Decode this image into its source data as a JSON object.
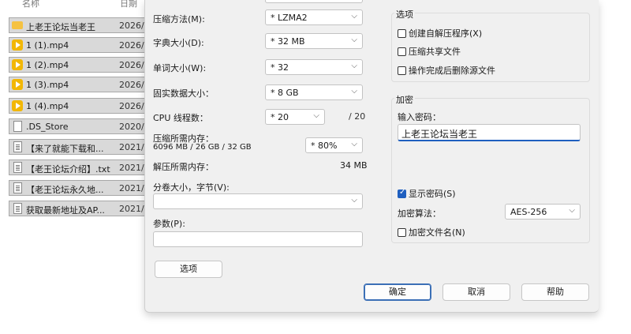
{
  "file_list": {
    "headers": {
      "name": "名称",
      "date": "日期"
    },
    "rows": [
      {
        "icon": "folder-icon",
        "name": "上老王论坛当老王",
        "date": "2026/"
      },
      {
        "icon": "video-icon",
        "name": "1 (1).mp4",
        "date": "2026/"
      },
      {
        "icon": "video-icon",
        "name": "1 (2).mp4",
        "date": "2026/"
      },
      {
        "icon": "video-icon",
        "name": "1 (3).mp4",
        "date": "2026/"
      },
      {
        "icon": "video-icon",
        "name": "1 (4).mp4",
        "date": "2026/"
      },
      {
        "icon": "file-icon",
        "name": ".DS_Store",
        "date": "2020/"
      },
      {
        "icon": "text-file-icon",
        "name": "【来了就能下载和...",
        "date": "2021/"
      },
      {
        "icon": "text-file-icon",
        "name": "【老王论坛介绍】.txt",
        "date": "2021/"
      },
      {
        "icon": "text-file-icon",
        "name": "【老王论坛永久地...",
        "date": "2021/"
      },
      {
        "icon": "text-file-icon",
        "name": "获取最新地址及AP...",
        "date": "2021/"
      }
    ]
  },
  "dialog": {
    "compression_method": {
      "label": "压缩方法(M):",
      "value": "* LZMA2"
    },
    "dictionary_size": {
      "label": "字典大小(D):",
      "value": "* 32 MB"
    },
    "word_size": {
      "label": "单词大小(W):",
      "value": "* 32"
    },
    "solid_block_size": {
      "label": "固实数据大小：",
      "value": "* 8 GB"
    },
    "cpu_threads": {
      "label": "CPU 线程数：",
      "value": "* 20",
      "max": "/ 20"
    },
    "memory_compress": {
      "label": "压缩所需内存：",
      "detail": "6096 MB / 26 GB / 32 GB",
      "percent": "* 80%"
    },
    "memory_decompress": {
      "label": "解压所需内存：",
      "value": "34 MB"
    },
    "split_volume": {
      "label": "分卷大小，字节(V):",
      "value": ""
    },
    "parameters": {
      "label": "参数(P):",
      "value": ""
    },
    "options_button": "选项",
    "options_group": {
      "title": "选项",
      "items": [
        {
          "label": "创建自解压程序(X)",
          "checked": false
        },
        {
          "label": "压缩共享文件",
          "checked": false
        },
        {
          "label": "操作完成后删除源文件",
          "checked": false
        }
      ]
    },
    "encryption_group": {
      "title": "加密",
      "password_label": "输入密码：",
      "password_value": "上老王论坛当老王",
      "show_password": {
        "label": "显示密码(S)",
        "checked": true
      },
      "method_label": "加密算法：",
      "method_value": "AES-256",
      "encrypt_names": {
        "label": "加密文件名(N)",
        "checked": false
      }
    },
    "buttons": {
      "ok": "确定",
      "cancel": "取消",
      "help": "帮助"
    }
  },
  "colors": {
    "accent": "#1f5fbf",
    "dialog_bg": "#f0f0f0",
    "row_bg": "#d9d9d9"
  }
}
